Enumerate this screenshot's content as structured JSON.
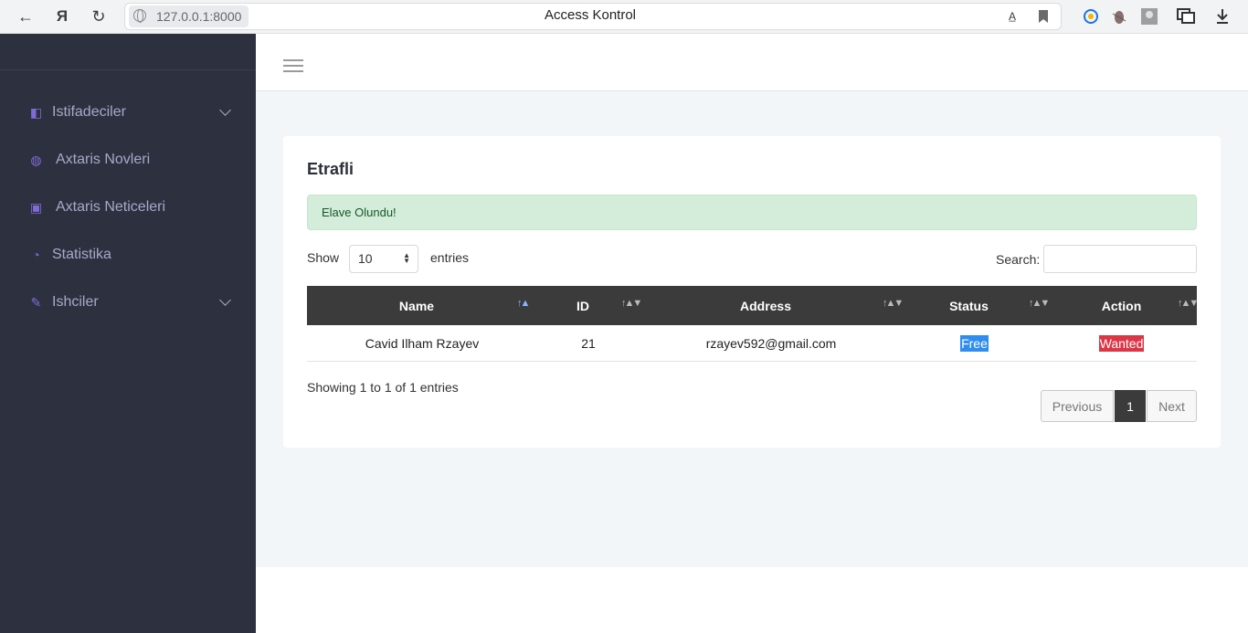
{
  "browser": {
    "url": "127.0.0.1:8000",
    "tab_title": "Access Kontrol",
    "back_glyph": "←",
    "yandex_glyph": "Я",
    "reload_glyph": "↻"
  },
  "sidebar": {
    "items": [
      {
        "label": "Istifadeciler",
        "icon": "layout-icon",
        "glyph": "◧"
      },
      {
        "label": "Axtaris Novleri",
        "icon": "palette-icon",
        "glyph": "◍"
      },
      {
        "label": "Axtaris Neticeleri",
        "icon": "briefcase-icon",
        "glyph": "▣"
      },
      {
        "label": "Statistika",
        "icon": "pie-chart-icon",
        "glyph": "◔"
      },
      {
        "label": "Ishciler",
        "icon": "pencil-icon",
        "glyph": "✎"
      }
    ]
  },
  "main": {
    "card_title": "Etrafli",
    "alert": "Elave Olundu!",
    "show_label": "Show",
    "entries_value": "10",
    "entries_label": "entries",
    "search_label": "Search:",
    "search_value": "",
    "columns": [
      "Name",
      "ID",
      "Address",
      "Status",
      "Action"
    ],
    "rows": [
      {
        "name": "Cavid Ilham Rzayev",
        "id": "21",
        "address": "rzayev592@gmail.com",
        "status": "Free",
        "action": "Wanted"
      }
    ],
    "info": "Showing 1 to 1 of 1 entries",
    "pagination": {
      "previous": "Previous",
      "current": "1",
      "next": "Next"
    }
  },
  "colors": {
    "sidebar_bg": "#2d313f",
    "accent": "#5e5ce6",
    "table_head": "#3b3b3b",
    "status_free": "#2f8df0",
    "action_wanted": "#dc3545",
    "alert_bg": "#d4eddb"
  }
}
